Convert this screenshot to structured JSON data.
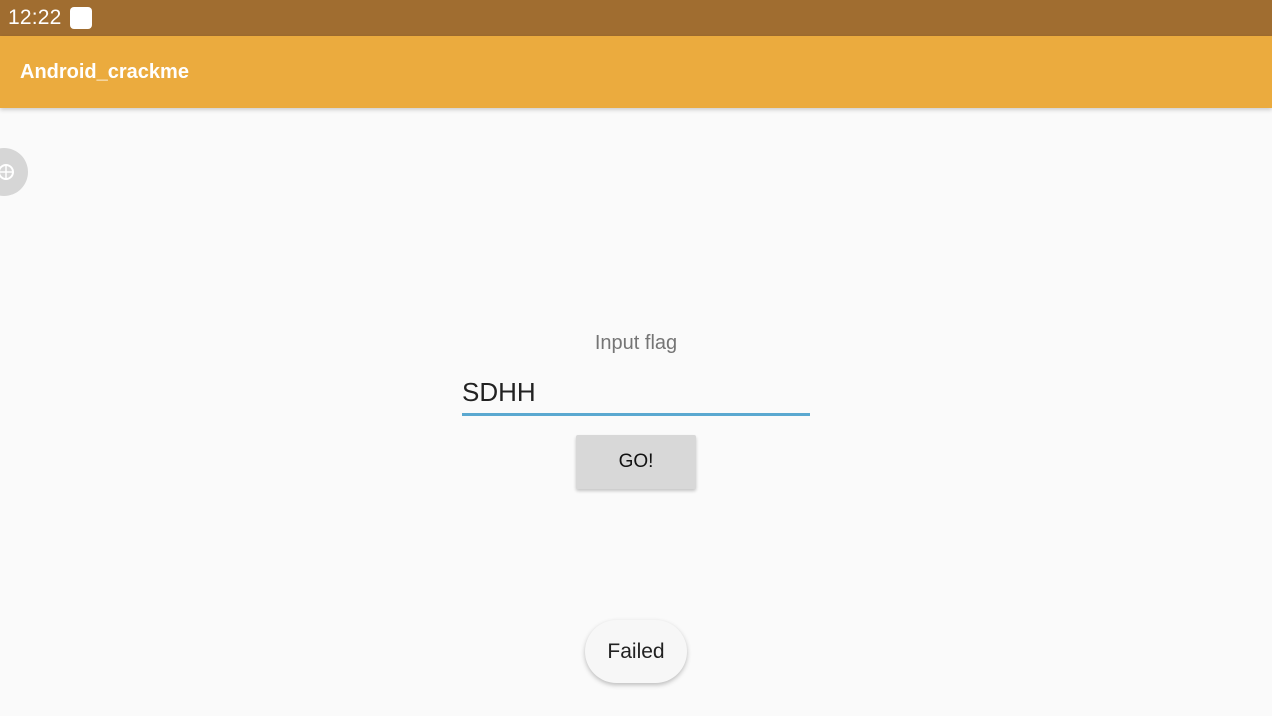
{
  "status_bar": {
    "time": "12:22",
    "notification_icon": "square-notification-icon",
    "background_color": "#a06d30"
  },
  "app_bar": {
    "title": "Android_crackme",
    "background_color": "#ebab3e"
  },
  "floating_tool": {
    "icon": "android-bug-icon"
  },
  "main": {
    "hint_label": "Input flag",
    "flag_input": {
      "value": "SDHH",
      "underline_color": "#5aa8d0"
    },
    "go_button_label": "GO!"
  },
  "toast": {
    "message": "Failed"
  }
}
